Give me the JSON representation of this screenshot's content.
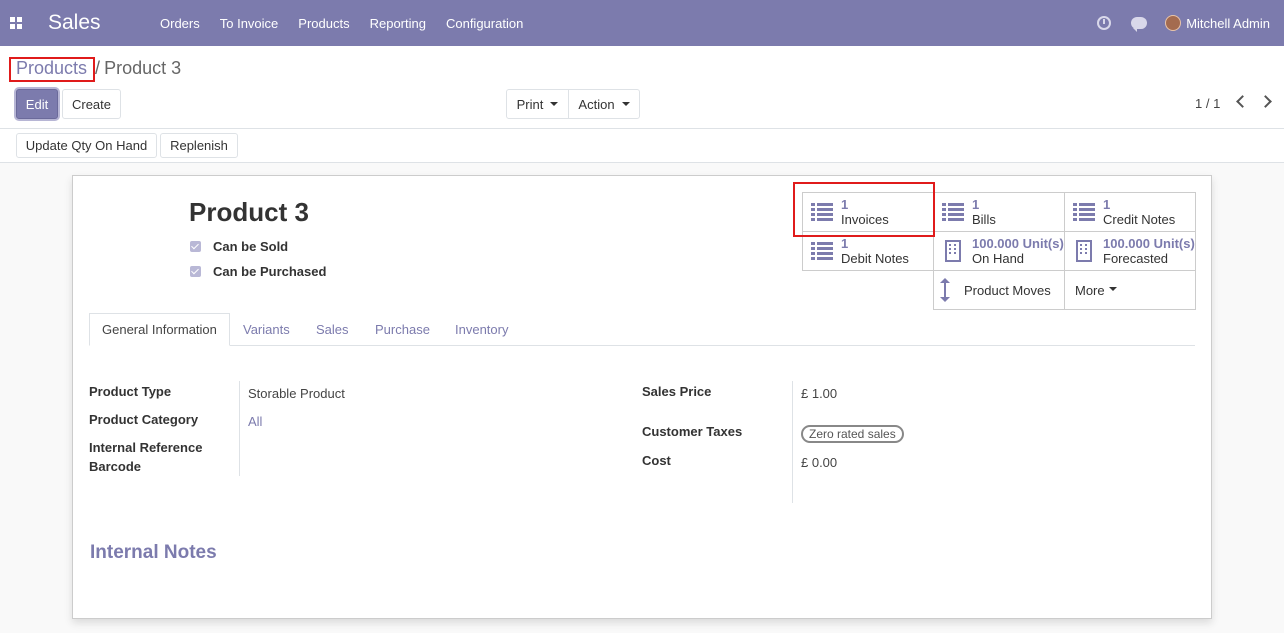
{
  "navbar": {
    "app_name": "Sales",
    "menu": [
      "Orders",
      "To Invoice",
      "Products",
      "Reporting",
      "Configuration"
    ],
    "user": "Mitchell Admin"
  },
  "breadcrumb": {
    "parent": "Products",
    "separator": "/",
    "current": "Product 3"
  },
  "buttons": {
    "edit": "Edit",
    "create": "Create",
    "print": "Print",
    "action": "Action",
    "update_qty": "Update Qty On Hand",
    "replenish": "Replenish"
  },
  "pager": "1 / 1",
  "product": {
    "name": "Product 3",
    "can_be_sold": "Can be Sold",
    "can_be_purchased": "Can be Purchased"
  },
  "smart_buttons": {
    "invoices": {
      "num": "1",
      "label": "Invoices"
    },
    "bills": {
      "num": "1",
      "label": "Bills"
    },
    "credit_notes": {
      "num": "1",
      "label": "Credit Notes"
    },
    "debit_notes": {
      "num": "1",
      "label": "Debit Notes"
    },
    "on_hand": {
      "num": "100.000",
      "unit": "Unit(s)",
      "label": "On Hand"
    },
    "forecasted": {
      "num": "100.000",
      "unit": "Unit(s)",
      "label": "Forecasted"
    },
    "product_moves": "Product Moves",
    "more": "More"
  },
  "tabs": [
    "General Information",
    "Variants",
    "Sales",
    "Purchase",
    "Inventory"
  ],
  "fields": {
    "product_type_label": "Product Type",
    "product_type": "Storable Product",
    "product_category_label": "Product Category",
    "product_category": "All",
    "internal_reference_label": "Internal Reference",
    "barcode_label": "Barcode",
    "sales_price_label": "Sales Price",
    "sales_price": "£ 1.00",
    "customer_taxes_label": "Customer Taxes",
    "customer_taxes": "Zero rated sales",
    "cost_label": "Cost",
    "cost": "£ 0.00"
  },
  "internal_notes_title": "Internal Notes",
  "colors": {
    "brand": "#7c7bad",
    "highlight": "#e01b1b"
  }
}
